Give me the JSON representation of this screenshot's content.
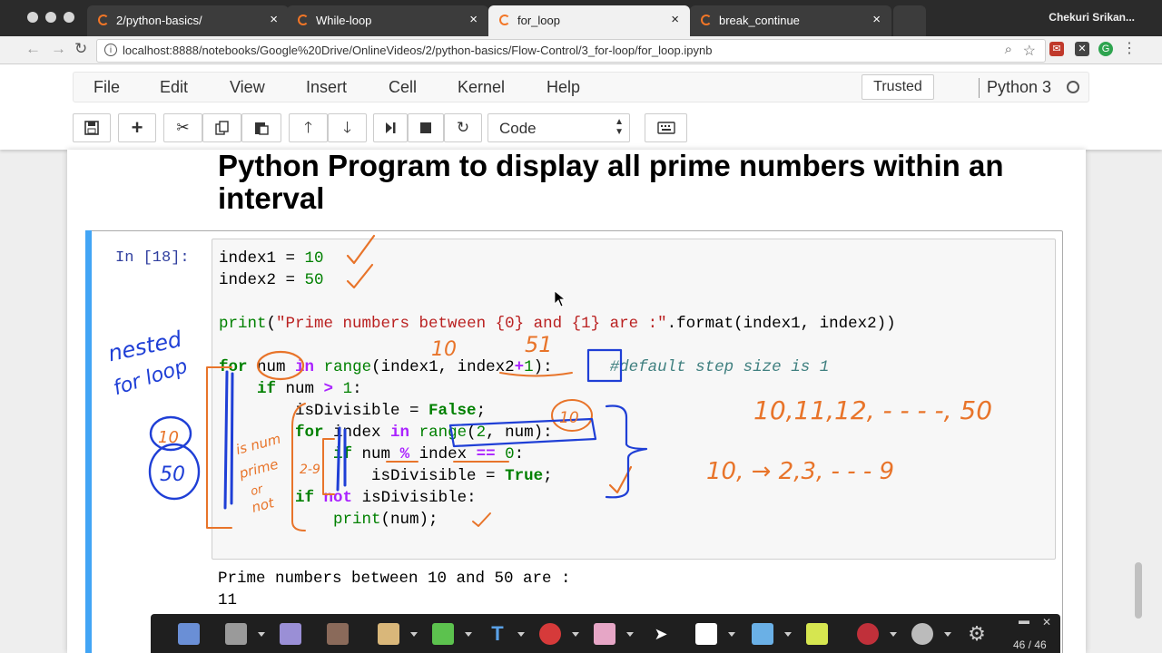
{
  "browser": {
    "tabs": [
      {
        "title": "2/python-basics/",
        "active": false
      },
      {
        "title": "While-loop",
        "active": false
      },
      {
        "title": "for_loop",
        "active": true
      },
      {
        "title": "break_continue",
        "active": false
      }
    ],
    "profile": "Chekuri Srikan...",
    "url": "localhost:8888/notebooks/Google%20Drive/OnlineVideos/2/python-basics/Flow-Control/3_for-loop/for_loop.ipynb"
  },
  "jupyter": {
    "menu": [
      "File",
      "Edit",
      "View",
      "Insert",
      "Cell",
      "Kernel",
      "Help"
    ],
    "trusted": "Trusted",
    "kernel": "Python 3",
    "cell_type": "Code"
  },
  "notebook": {
    "heading": "Python Program to display all prime numbers within an interval",
    "prompt": "In [18]:",
    "output": [
      "Prime numbers between 10 and 50 are :",
      "11"
    ]
  },
  "annotations": {
    "note_nested": [
      "nested",
      "for loop"
    ],
    "note_10": "10",
    "note_51": "51",
    "note_range": "10,11,12, - - - -, 50",
    "note_inner": "10, → 2,3, - - - 9",
    "note_circle_10": "10",
    "note_circle_50": "50",
    "note_circle_index_10": "10",
    "note_is_num_prime": [
      "is num",
      "prime",
      "or",
      "not"
    ],
    "note_2_9": "2-9"
  },
  "drawing_toolbar": {
    "page": "46 / 46"
  },
  "colors": {
    "jupyter_orange": "#f37626",
    "cell_selected": "#42a5f5",
    "pen_orange": "#e8742a",
    "pen_blue": "#1f3fd6"
  }
}
